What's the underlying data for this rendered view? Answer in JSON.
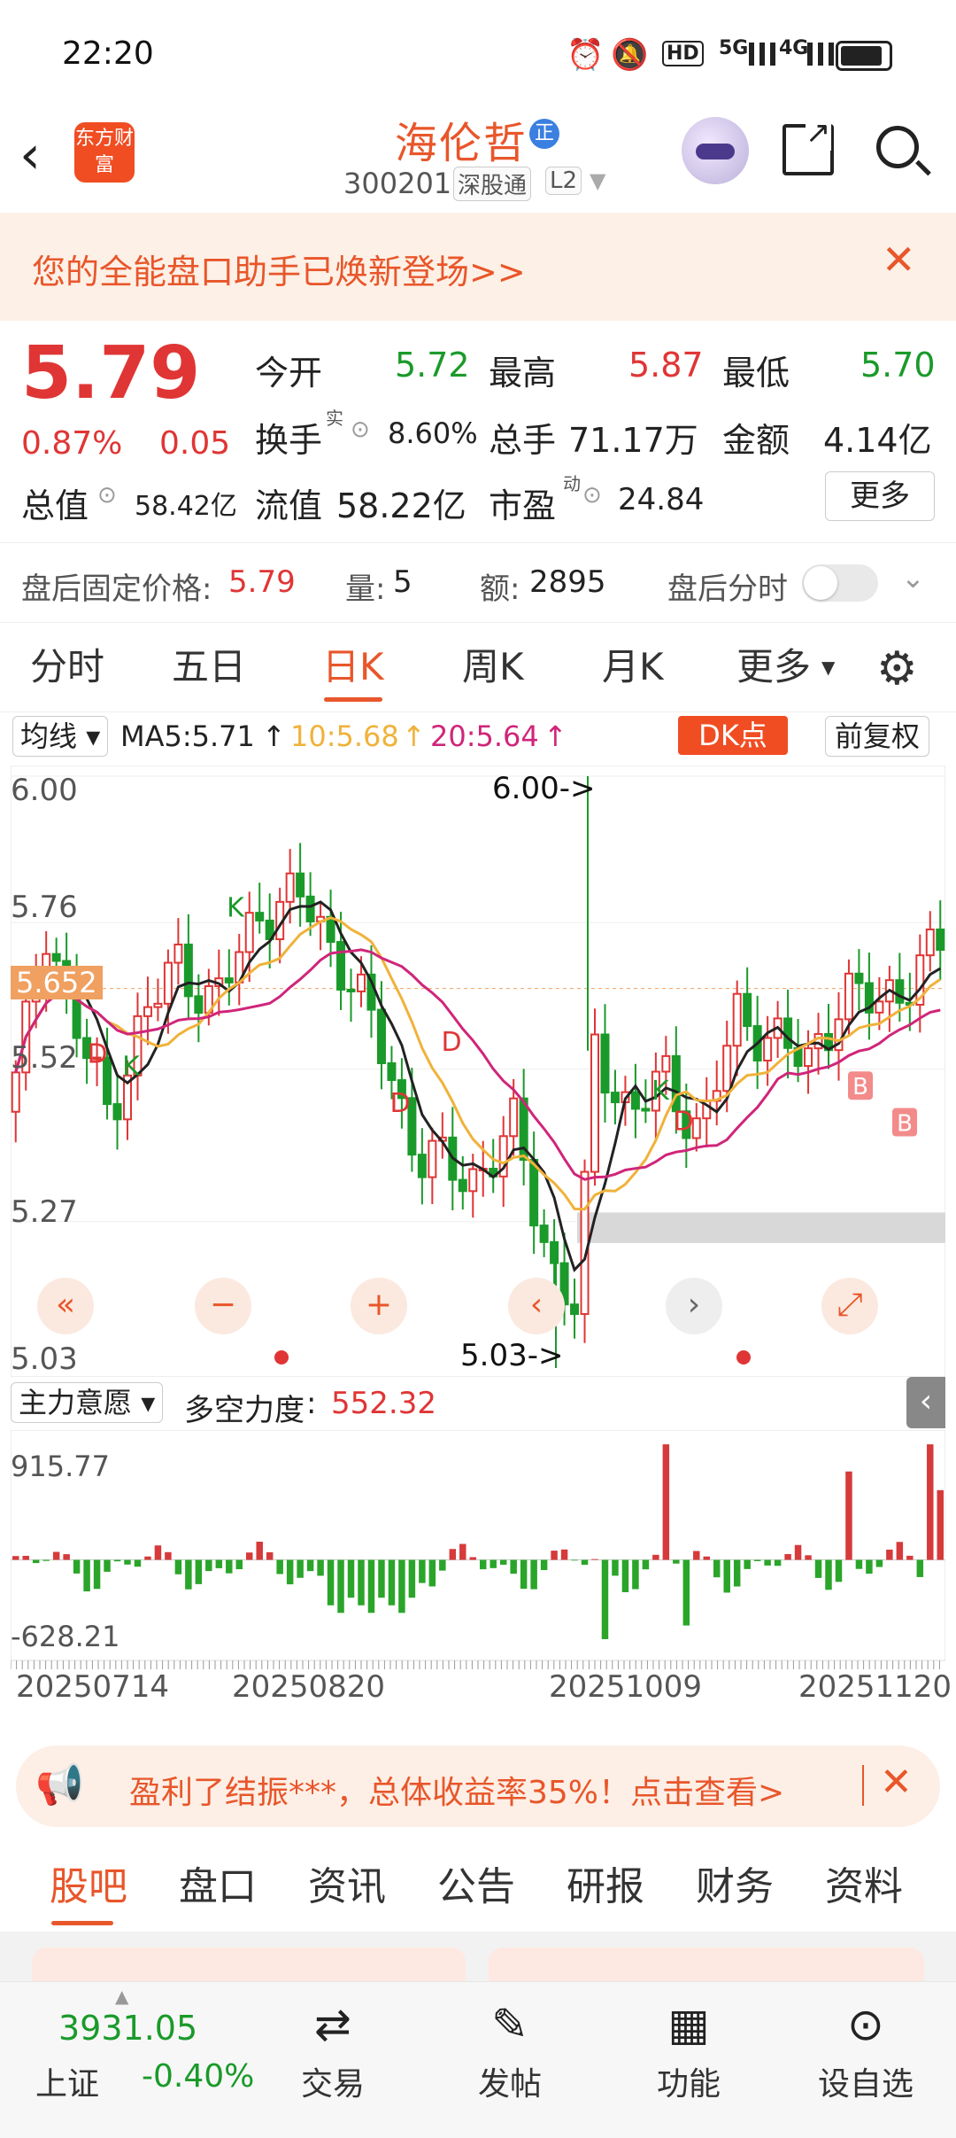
{
  "status": {
    "time": "22:20",
    "signal_5g": "5G",
    "signal_4g": "4G",
    "hd": "HD"
  },
  "header": {
    "brand_logo": "东方财富",
    "stock_name": "海伦哲",
    "badge": "正",
    "code": "300201",
    "market_tag": "深股通",
    "level_tag": "L2"
  },
  "banner": {
    "text": "您的全能盘口助手已焕新登场>>"
  },
  "quote": {
    "price": "5.79",
    "change_pct": "0.87%",
    "change_amt": "0.05",
    "open_label": "今开",
    "open": "5.72",
    "high_label": "最高",
    "high": "5.87",
    "low_label": "最低",
    "low": "5.70",
    "turnover_label": "换手",
    "turnover_sup": "实",
    "turnover": "8.60%",
    "volume_label": "总手",
    "volume": "71.17万",
    "amount_label": "金额",
    "amount": "4.14亿",
    "mcap_label": "总值",
    "mcap": "58.42亿",
    "float_label": "流值",
    "float": "58.22亿",
    "pe_label": "市盈",
    "pe_sup": "动",
    "pe": "24.84",
    "more": "更多"
  },
  "afterhours": {
    "price_label": "盘后固定价格:",
    "price": "5.79",
    "vol_label": "量:",
    "vol": "5",
    "amt_label": "额:",
    "amt": "2895",
    "timeshare": "盘后分时"
  },
  "tabs": [
    "分时",
    "五日",
    "日K",
    "周K",
    "月K",
    "更多"
  ],
  "ma_legend": {
    "selector": "均线",
    "ma5": "MA5:5.71",
    "ma10": "10:5.68",
    "ma20": "20:5.64",
    "dk": "DK点",
    "adjust": "前复权"
  },
  "chart_data": [
    {
      "type": "candlestick",
      "y_ticks": [
        "6.00",
        "5.76",
        "5.52",
        "5.27",
        "5.03"
      ],
      "current_level": "5.652",
      "high_annotation": "6.00->",
      "low_annotation": "5.03->",
      "ylim": [
        5.03,
        6.0
      ],
      "signals": [
        "K",
        "D",
        "K",
        "D",
        "D",
        "K",
        "D",
        "B",
        "B"
      ],
      "colors": {
        "up": "#e03535",
        "down": "#1a9a2a",
        "ma5": "#222222",
        "ma10": "#f0b23a",
        "ma20": "#d0257a"
      }
    },
    {
      "type": "bar",
      "title": "多空力度",
      "selector": "主力意愿",
      "value": "552.32",
      "ylim": [
        -628.21,
        915.77
      ],
      "y_ticks": [
        "915.77",
        "-628.21"
      ],
      "x_ticks": [
        "20250714",
        "20250820",
        "20251009",
        "20251120"
      ]
    }
  ],
  "ad": {
    "text": "盈利了结振***，总体收益率35%！点击查看>"
  },
  "bottom_tabs": [
    "股吧",
    "盘口",
    "资讯",
    "公告",
    "研报",
    "财务",
    "资料"
  ],
  "footer": {
    "index_value": "3931.05",
    "index_name": "上证",
    "index_change": "-0.40%",
    "items": [
      "交易",
      "发帖",
      "功能",
      "设自选"
    ]
  }
}
